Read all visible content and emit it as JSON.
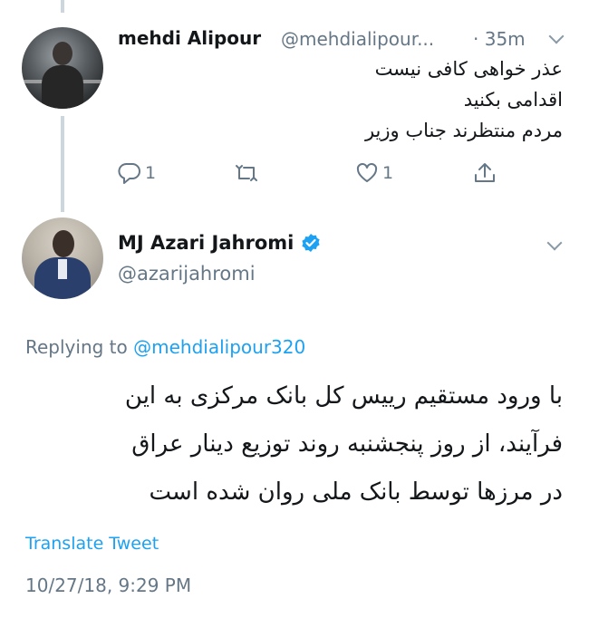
{
  "parent_tweet": {
    "name": "mehdi Alipour",
    "handle": "@mehdialipour...",
    "time": "· 35m",
    "lines": [
      "عذر خواهی کافی نیست",
      "اقدامی بکنید",
      "مردم منتظرند جناب وزیر"
    ],
    "reply_count": "1",
    "retweet_count": "",
    "like_count": "1"
  },
  "main_tweet": {
    "name": "MJ Azari Jahromi",
    "handle": "@azarijahromi",
    "replying_prefix": "Replying to ",
    "replying_to": "@mehdialipour320",
    "lines": [
      "با ورود مستقیم رییس کل بانک مرکزی به این",
      "فرآیند، از روز پنجشنبه روند توزیع دینار عراق",
      "در مرزها توسط بانک ملی روان شده است"
    ],
    "translate_label": "Translate Tweet",
    "timestamp": "10/27/18, 9:29 PM"
  },
  "colors": {
    "link": "#1da1f2",
    "muted": "#657786",
    "text": "#14171a",
    "thread_line": "#ccd6dd"
  },
  "icons": [
    "reply-icon",
    "retweet-icon",
    "like-icon",
    "share-icon",
    "verified-badge-icon",
    "chevron-down-icon"
  ]
}
